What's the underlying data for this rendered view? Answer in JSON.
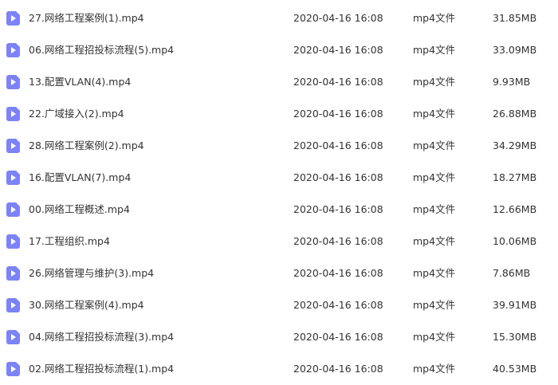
{
  "files": [
    {
      "name": "27.网络工程案例(1).mp4",
      "modified": "2020-04-16 16:08",
      "type": "mp4文件",
      "size": "31.85MB",
      "icon": "video-file-icon"
    },
    {
      "name": "06.网络工程招投标流程(5).mp4",
      "modified": "2020-04-16 16:08",
      "type": "mp4文件",
      "size": "33.09MB",
      "icon": "video-file-icon"
    },
    {
      "name": "13.配置VLAN(4).mp4",
      "modified": "2020-04-16 16:08",
      "type": "mp4文件",
      "size": "9.93MB",
      "icon": "video-file-icon"
    },
    {
      "name": "22.广域接入(2).mp4",
      "modified": "2020-04-16 16:08",
      "type": "mp4文件",
      "size": "26.88MB",
      "icon": "video-file-icon"
    },
    {
      "name": "28.网络工程案例(2).mp4",
      "modified": "2020-04-16 16:08",
      "type": "mp4文件",
      "size": "34.29MB",
      "icon": "video-file-icon"
    },
    {
      "name": "16.配置VLAN(7).mp4",
      "modified": "2020-04-16 16:08",
      "type": "mp4文件",
      "size": "18.27MB",
      "icon": "video-file-icon"
    },
    {
      "name": "00.网络工程概述.mp4",
      "modified": "2020-04-16 16:08",
      "type": "mp4文件",
      "size": "12.66MB",
      "icon": "video-file-icon"
    },
    {
      "name": "17.工程组织.mp4",
      "modified": "2020-04-16 16:08",
      "type": "mp4文件",
      "size": "10.06MB",
      "icon": "video-file-icon"
    },
    {
      "name": "26.网络管理与维护(3).mp4",
      "modified": "2020-04-16 16:08",
      "type": "mp4文件",
      "size": "7.86MB",
      "icon": "video-file-icon"
    },
    {
      "name": "30.网络工程案例(4).mp4",
      "modified": "2020-04-16 16:08",
      "type": "mp4文件",
      "size": "39.91MB",
      "icon": "video-file-icon"
    },
    {
      "name": "04.网络工程招投标流程(3).mp4",
      "modified": "2020-04-16 16:08",
      "type": "mp4文件",
      "size": "15.30MB",
      "icon": "video-file-icon"
    },
    {
      "name": "02.网络工程招投标流程(1).mp4",
      "modified": "2020-04-16 16:08",
      "type": "mp4文件",
      "size": "40.53MB",
      "icon": "video-file-icon"
    }
  ],
  "colors": {
    "icon": "#7c83f7",
    "text": "#333333",
    "background": "#ffffff"
  }
}
